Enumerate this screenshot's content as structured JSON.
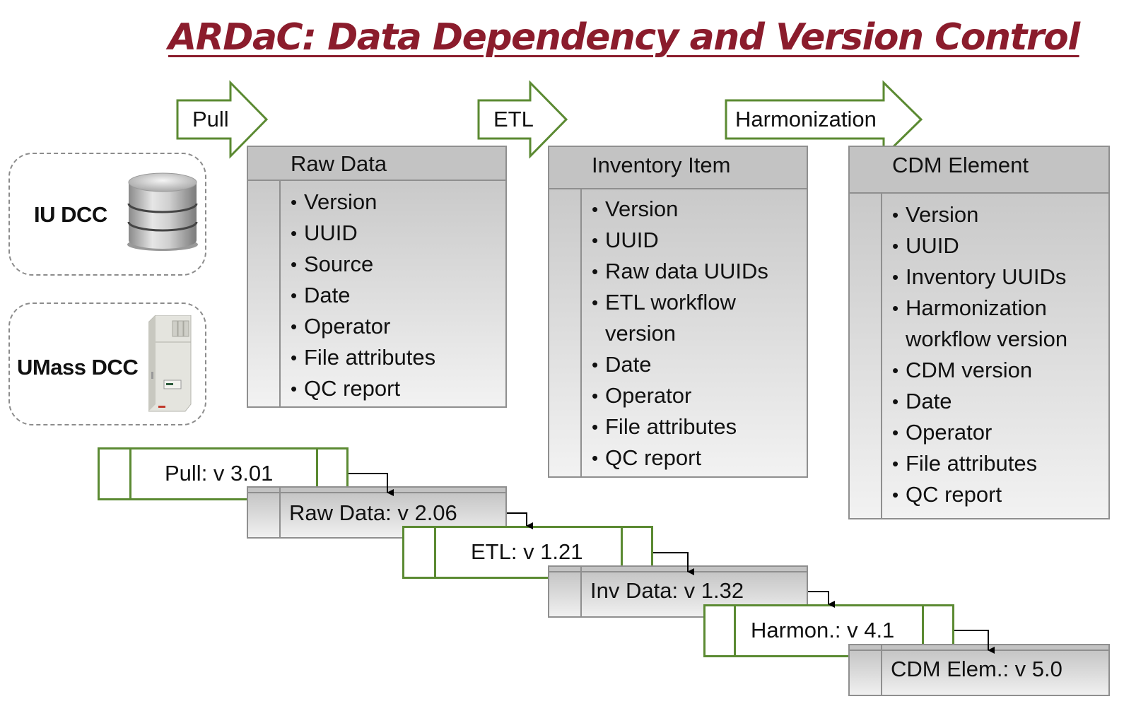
{
  "title": "ARDaC: Data Dependency and Version Control",
  "colors": {
    "title": "#8b1c2c",
    "process_border": "#5b8a32",
    "entity_border": "#8f8f8f",
    "entity_fill_top": "#c3c3c3",
    "entity_fill_bottom": "#f2f2f2"
  },
  "process_arrows": [
    {
      "label": "Pull"
    },
    {
      "label": "ETL"
    },
    {
      "label": "Harmonization"
    }
  ],
  "sources": [
    {
      "label": "IU DCC",
      "icon": "database-icon"
    },
    {
      "label": "UMass DCC",
      "icon": "server-cabinet-icon"
    }
  ],
  "entities": [
    {
      "title": "Raw Data",
      "attributes": [
        "Version",
        "UUID",
        "Source",
        "Date",
        "Operator",
        "File attributes",
        "QC report"
      ]
    },
    {
      "title": "Inventory Item",
      "attributes": [
        "Version",
        "UUID",
        "Raw data UUIDs",
        "ETL workflow version",
        "Date",
        "Operator",
        "File attributes",
        "QC report"
      ]
    },
    {
      "title": "CDM Element",
      "attributes": [
        "Version",
        "UUID",
        "Inventory UUIDs",
        "Harmonization workflow version",
        "CDM version",
        "Date",
        "Operator",
        "File attributes",
        "QC report"
      ]
    }
  ],
  "version_chain": [
    {
      "kind": "process",
      "label": "Pull: v 3.01"
    },
    {
      "kind": "data",
      "label": "Raw Data: v 2.06"
    },
    {
      "kind": "process",
      "label": "ETL: v 1.21"
    },
    {
      "kind": "data",
      "label": "Inv Data: v 1.32"
    },
    {
      "kind": "process",
      "label": "Harmon.: v 4.1"
    },
    {
      "kind": "data",
      "label": "CDM Elem.: v 5.0"
    }
  ]
}
